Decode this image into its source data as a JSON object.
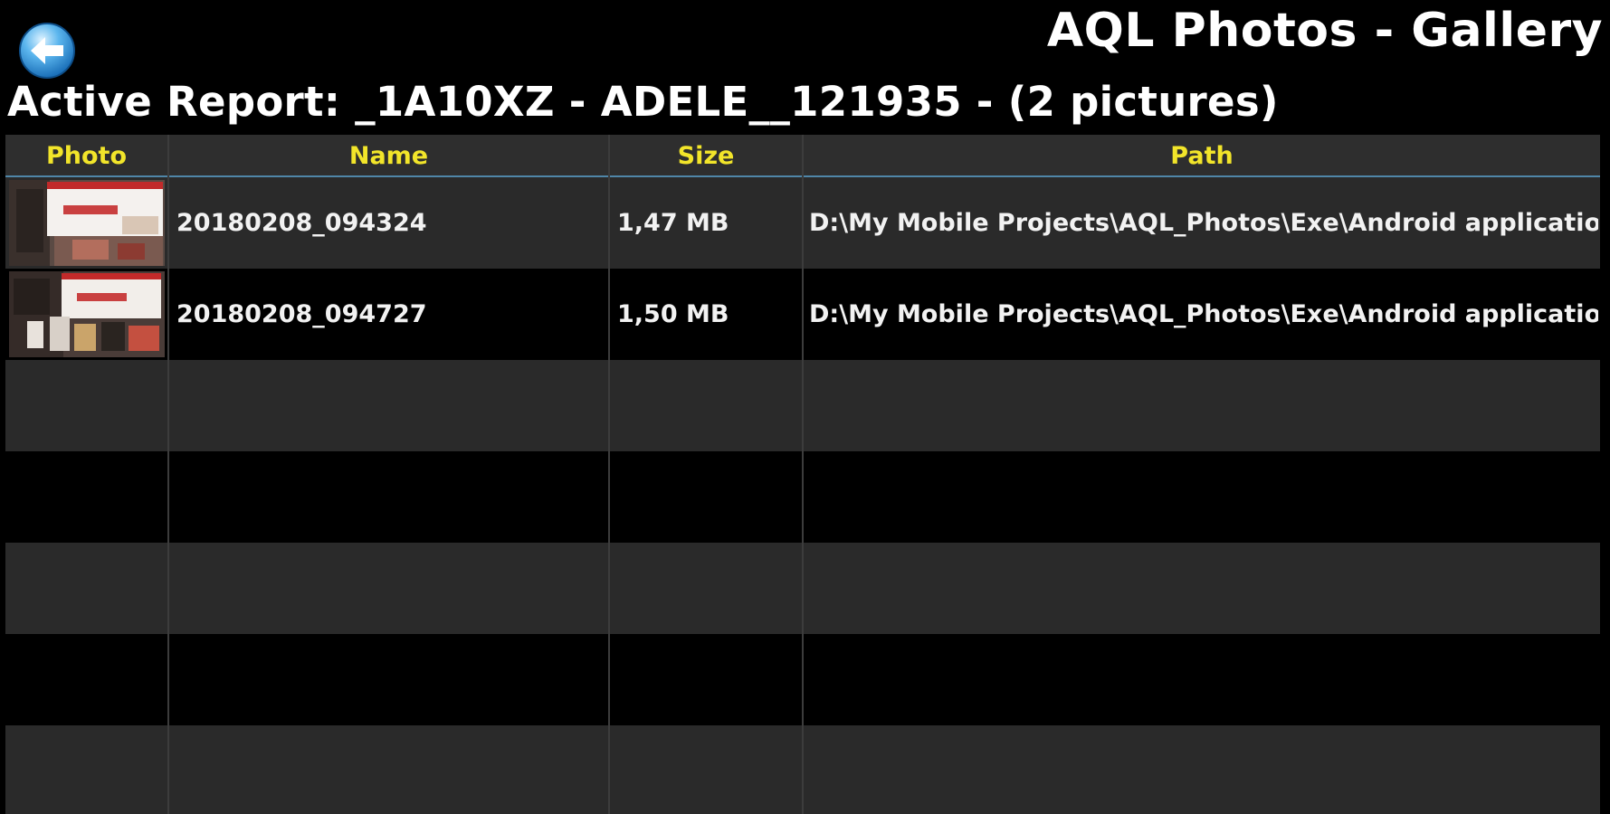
{
  "header": {
    "title": "AQL Photos - Gallery",
    "report_line": "Active Report: _1A10XZ - ADELE__121935 - (2 pictures)",
    "back_icon": "back-arrow-icon"
  },
  "table": {
    "columns": {
      "photo": "Photo",
      "name": "Name",
      "size": "Size",
      "path": "Path"
    },
    "rows": [
      {
        "name": "20180208_094324",
        "size": "1,47 MB",
        "path": "D:\\My Mobile Projects\\AQL_Photos\\Exe\\Android application\\Dat"
      },
      {
        "name": "20180208_094727",
        "size": "1,50 MB",
        "path": "D:\\My Mobile Projects\\AQL_Photos\\Exe\\Android application\\Dat"
      }
    ]
  },
  "colors": {
    "background": "#000000",
    "header_text": "#f2e52a",
    "header_bg": "#2e2e2e",
    "row_alt": "#2a2a2a",
    "accent_line": "#4f86a8"
  }
}
